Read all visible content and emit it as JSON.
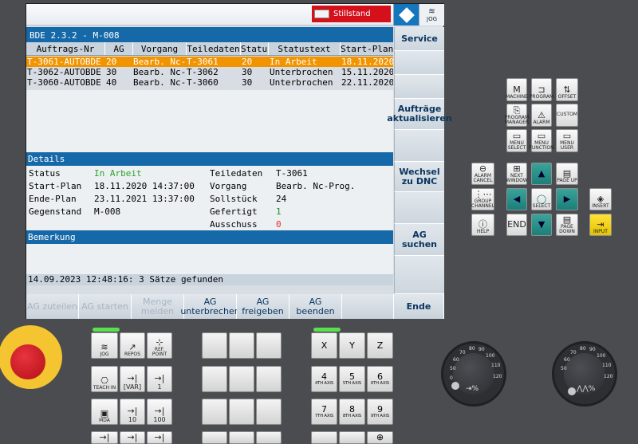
{
  "alarm": {
    "text": "Stillstand"
  },
  "corner": {
    "jog_label": "JOG"
  },
  "window": {
    "title": "BDE 2.3.2 - M-008"
  },
  "table": {
    "headers": [
      "Auftrags-Nr",
      "AG",
      "Vorgang",
      "Teiledaten",
      "Status",
      "Statustext",
      "Start-Plan"
    ],
    "rows": [
      [
        "T-3061-AUTOBDE",
        "20",
        "Bearb. Nc-...",
        "T-3061",
        "20",
        "In Arbeit",
        "18.11.2020 ..."
      ],
      [
        "T-3062-AUTOBDE",
        "30",
        "Bearb. Nc-...",
        "T-3062",
        "30",
        "Unterbrochen",
        "15.11.2020 ..."
      ],
      [
        "T-3060-AUTOBDE",
        "40",
        "Bearb. Nc-...",
        "T-3060",
        "30",
        "Unterbrochen",
        "22.11.2020 ..."
      ]
    ]
  },
  "details": {
    "heading": "Details",
    "status_label": "Status",
    "status_value": "In Arbeit",
    "start_label": "Start-Plan",
    "start_value": "18.11.2020 14:37:00",
    "end_label": "Ende-Plan",
    "end_value": "23.11.2021 13:37:00",
    "gegen_label": "Gegenstand",
    "gegen_value": "M-008",
    "teile_label": "Teiledaten",
    "teile_value": "T-3061",
    "vorgang_label": "Vorgang",
    "vorgang_value": "Bearb. Nc-Prog.",
    "soll_label": "Sollstück",
    "soll_value": "24",
    "gef_label": "Gefertigt",
    "gef_value": "1",
    "aus_label": "Ausschuss",
    "aus_value": "0"
  },
  "remark": {
    "heading": "Bemerkung"
  },
  "status_bar": "14.09.2023 12:48:16: 3 Sätze gefunden",
  "vertical_softkeys": [
    "Service",
    "Aufträge aktualisieren",
    "Wechsel zu DNC",
    "AG suchen",
    "Ende"
  ],
  "horizontal_softkeys": [
    {
      "label": "AG zuteilen",
      "enabled": false
    },
    {
      "label": "AG starten",
      "enabled": false
    },
    {
      "label": "Menge melden",
      "enabled": false
    },
    {
      "label": "AG unterbrechen",
      "enabled": true
    },
    {
      "label": "AG freigeben",
      "enabled": true
    },
    {
      "label": "AG beenden",
      "enabled": true
    },
    {
      "label": "",
      "enabled": false
    }
  ],
  "keypad": {
    "machine": "MACHINE",
    "program": "PROGRAM",
    "offset": "OFFSET",
    "prog_manager": "PROGRAM MANAGER",
    "alarm": "ALARM",
    "custom": "CUSTOM",
    "menu_select": "MENU SELECT",
    "menu_function": "MENU FUNCTION",
    "menu_user": "MENU USER",
    "alarm_cancel": "ALARM CANCEL",
    "next_window": "NEXT WINDOW",
    "page_up": "PAGE UP",
    "group_channel": "GROUP CHANNEL",
    "select": "SELECT",
    "insert": "INSERT",
    "help": "HELP",
    "end": "END",
    "page_down": "PAGE DOWN",
    "input": "INPUT"
  },
  "mcp": {
    "jog": "JOG",
    "repos": "REPOS",
    "ref_point": "REF. POINT",
    "teach_in": "TEACH IN",
    "var": "[VAR]",
    "inc1": "1",
    "mda": "MDA",
    "inc10": "10",
    "inc100": "100"
  },
  "axes": {
    "x": "X",
    "y": "Y",
    "z": "Z",
    "a4": "4",
    "a4s": "4TH AXIS",
    "a5": "5",
    "a5s": "5TH AXIS",
    "a6": "6",
    "a6s": "6TH AXIS",
    "a7": "7",
    "a7s": "7TH AXIS",
    "a8": "8",
    "a8s": "8TH AXIS",
    "a9": "9",
    "a9s": "9TH AXIS"
  },
  "feed_knob": {
    "ticks": [
      "0",
      "50",
      "60",
      "70",
      "80",
      "90",
      "100",
      "110",
      "120"
    ]
  },
  "spindle_knob": {
    "ticks": [
      "50",
      "60",
      "70",
      "80",
      "90",
      "100",
      "110",
      "120"
    ]
  },
  "colors": {
    "accent_blue": "#1669a9",
    "selected_row": "#f29400",
    "alarm_red": "#d5101b",
    "status_green": "#2aa52a",
    "scrap_red": "#e0302a"
  }
}
